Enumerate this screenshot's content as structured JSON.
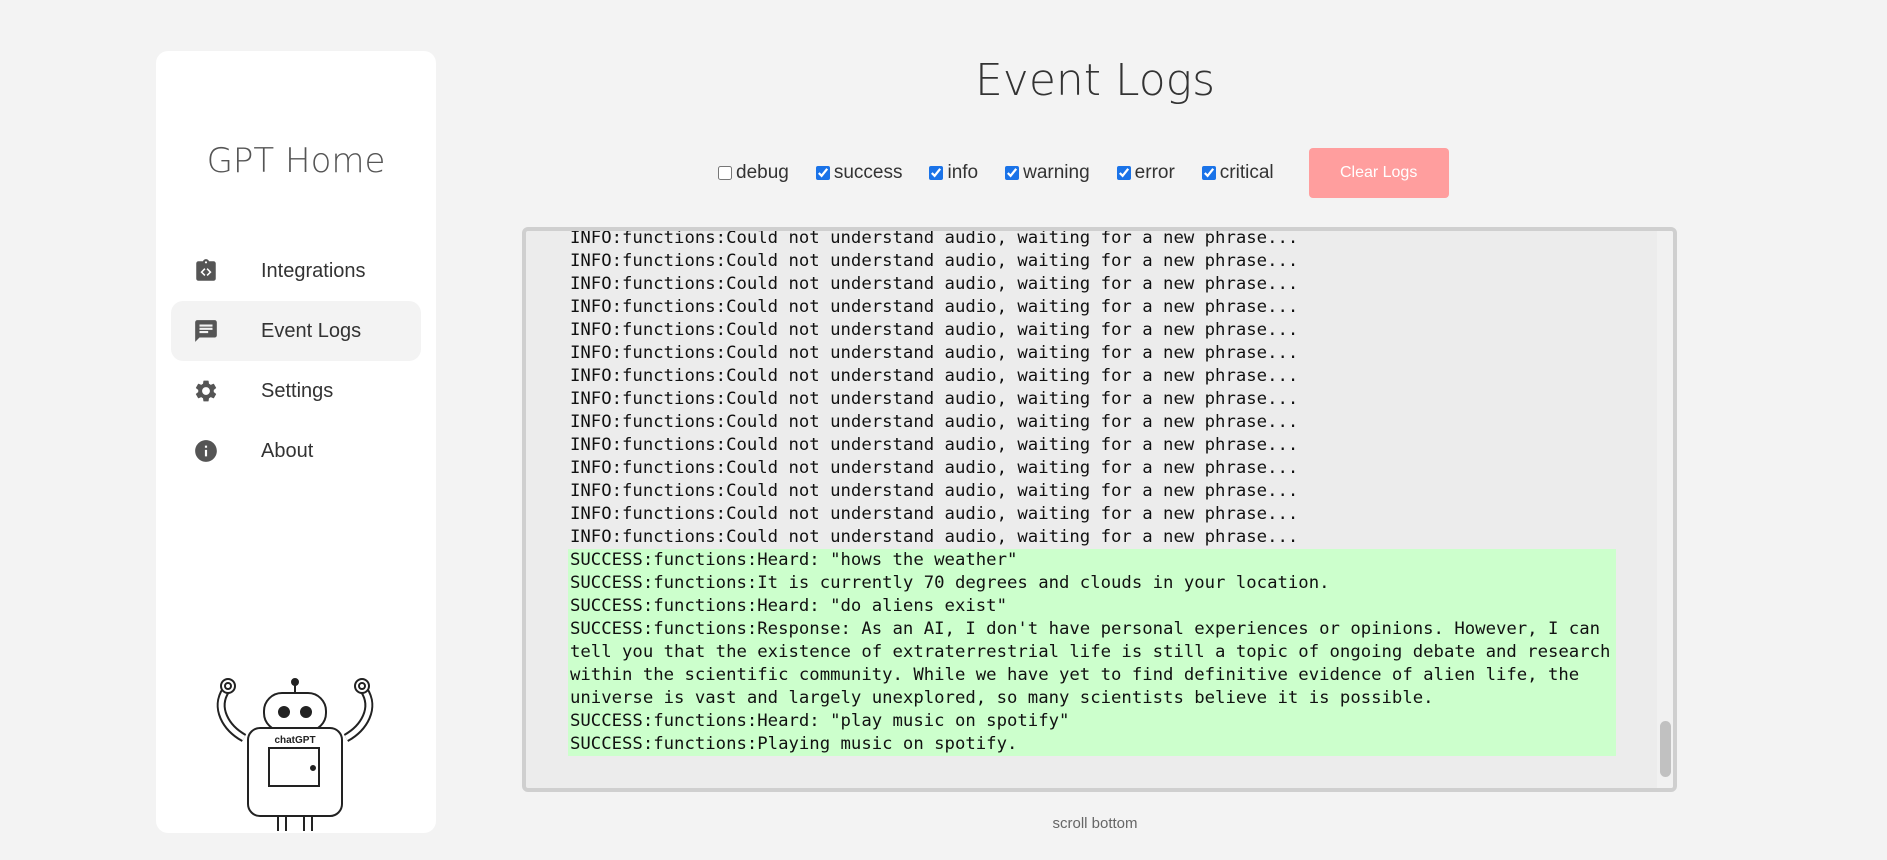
{
  "sidebar": {
    "app_title": "GPT Home",
    "items": [
      {
        "label": "Integrations",
        "icon": "integrations-icon",
        "active": false
      },
      {
        "label": "Event Logs",
        "icon": "event-logs-icon",
        "active": true
      },
      {
        "label": "Settings",
        "icon": "gear-icon",
        "active": false
      },
      {
        "label": "About",
        "icon": "info-icon",
        "active": false
      }
    ],
    "robot_label": "chatGPT"
  },
  "main": {
    "title": "Event Logs",
    "filters": [
      {
        "label": "debug",
        "checked": false
      },
      {
        "label": "success",
        "checked": true
      },
      {
        "label": "info",
        "checked": true
      },
      {
        "label": "warning",
        "checked": true
      },
      {
        "label": "error",
        "checked": true
      },
      {
        "label": "critical",
        "checked": true
      }
    ],
    "clear_button": "Clear Logs",
    "logs": [
      {
        "level": "info",
        "text": "INFO:functions:Could not understand audio, waiting for a new phrase..."
      },
      {
        "level": "info",
        "text": "INFO:functions:Could not understand audio, waiting for a new phrase..."
      },
      {
        "level": "info",
        "text": "INFO:functions:Could not understand audio, waiting for a new phrase..."
      },
      {
        "level": "info",
        "text": "INFO:functions:Could not understand audio, waiting for a new phrase..."
      },
      {
        "level": "info",
        "text": "INFO:functions:Could not understand audio, waiting for a new phrase..."
      },
      {
        "level": "info",
        "text": "INFO:functions:Could not understand audio, waiting for a new phrase..."
      },
      {
        "level": "info",
        "text": "INFO:functions:Could not understand audio, waiting for a new phrase..."
      },
      {
        "level": "info",
        "text": "INFO:functions:Could not understand audio, waiting for a new phrase..."
      },
      {
        "level": "info",
        "text": "INFO:functions:Could not understand audio, waiting for a new phrase..."
      },
      {
        "level": "info",
        "text": "INFO:functions:Could not understand audio, waiting for a new phrase..."
      },
      {
        "level": "info",
        "text": "INFO:functions:Could not understand audio, waiting for a new phrase..."
      },
      {
        "level": "info",
        "text": "INFO:functions:Could not understand audio, waiting for a new phrase..."
      },
      {
        "level": "info",
        "text": "INFO:functions:Could not understand audio, waiting for a new phrase..."
      },
      {
        "level": "info",
        "text": "INFO:functions:Could not understand audio, waiting for a new phrase..."
      },
      {
        "level": "success",
        "text": "SUCCESS:functions:Heard: \"hows the weather\""
      },
      {
        "level": "success",
        "text": "SUCCESS:functions:It is currently 70 degrees and clouds in your location."
      },
      {
        "level": "success",
        "text": "SUCCESS:functions:Heard: \"do aliens exist\""
      },
      {
        "level": "success",
        "text": "SUCCESS:functions:Response: As an AI, I don't have personal experiences or opinions. However, I can tell you that the existence of extraterrestrial life is still a topic of ongoing debate and research within the scientific community. While we have yet to find definitive evidence of alien life, the universe is vast and largely unexplored, so many scientists believe it is possible."
      },
      {
        "level": "success",
        "text": "SUCCESS:functions:Heard: \"play music on spotify\""
      },
      {
        "level": "success",
        "text": "SUCCESS:functions:Playing music on spotify."
      }
    ],
    "scroll_bottom": "scroll bottom"
  }
}
